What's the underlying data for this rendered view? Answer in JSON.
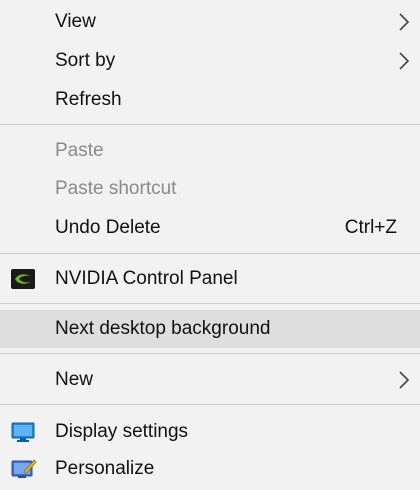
{
  "menu": {
    "view": {
      "label": "View",
      "icon": "chevron-right-icon"
    },
    "sort_by": {
      "label": "Sort by",
      "icon": "chevron-right-icon"
    },
    "refresh": {
      "label": "Refresh"
    },
    "paste": {
      "label": "Paste",
      "disabled": true
    },
    "paste_shortcut": {
      "label": "Paste shortcut",
      "disabled": true
    },
    "undo_delete": {
      "label": "Undo Delete",
      "shortcut": "Ctrl+Z"
    },
    "nvidia": {
      "label": "NVIDIA Control Panel",
      "icon": "nvidia-icon",
      "icon_color": "#76b900"
    },
    "next_bg": {
      "label": "Next desktop background",
      "highlighted": true
    },
    "new": {
      "label": "New",
      "icon": "chevron-right-icon"
    },
    "display_settings": {
      "label": "Display settings",
      "icon": "display-icon",
      "icon_color": "#1e88d6"
    },
    "personalize": {
      "label": "Personalize",
      "icon": "personalize-icon",
      "icon_color": "#3a6fd8"
    }
  }
}
